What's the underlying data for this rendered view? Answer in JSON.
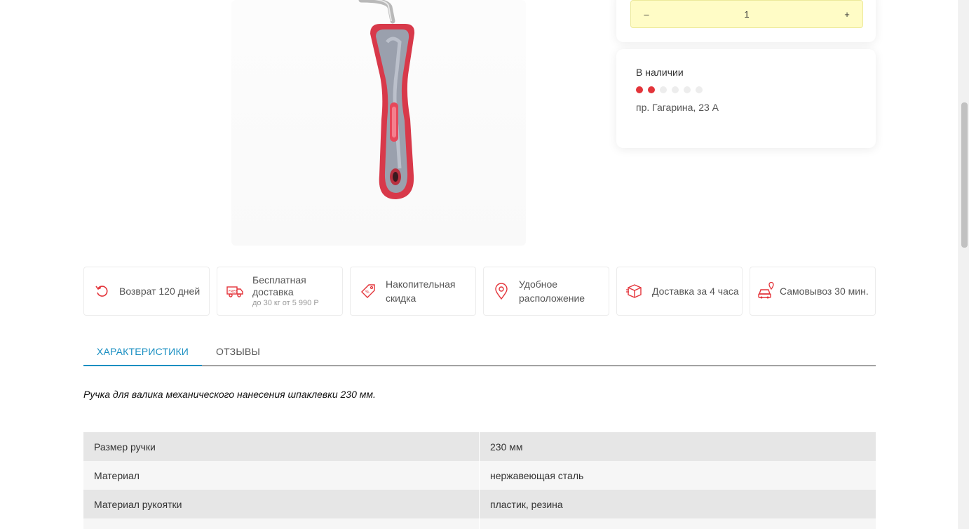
{
  "quantity": {
    "minus_label": "–",
    "value": "1",
    "plus_label": "+"
  },
  "stock": {
    "title": "В наличии",
    "level_filled": 2,
    "level_total": 6,
    "address": "пр. Гагарина, 23 А"
  },
  "features": [
    {
      "icon": "return-arrow-icon",
      "label": "Возврат 120 дней",
      "sub": ""
    },
    {
      "icon": "delivery-truck-icon",
      "label": "Бесплатная доставка",
      "sub": "до 30 кг от 5 990 Р"
    },
    {
      "icon": "discount-tag-icon",
      "label": "Накопительная скидка",
      "sub": ""
    },
    {
      "icon": "location-pin-icon",
      "label": "Удобное расположение",
      "sub": ""
    },
    {
      "icon": "box-icon",
      "label": "Доставка за 4 часа",
      "sub": ""
    },
    {
      "icon": "car-pickup-icon",
      "label": "Самовывоз 30 мин.",
      "sub": ""
    }
  ],
  "tabs": [
    {
      "label": "Характеристики",
      "active": true
    },
    {
      "label": "Отзывы",
      "active": false
    }
  ],
  "description": "Ручка для валика механического нанесения шпаклевки 230 мм.",
  "specs": [
    {
      "key": "Размер ручки",
      "value": "230 мм"
    },
    {
      "key": "Материал",
      "value": "нержавеющая сталь"
    },
    {
      "key": "Материал рукоятки",
      "value": "пластик, резина"
    },
    {
      "key": "",
      "value": ""
    }
  ],
  "colors": {
    "accent_red": "#e3343a",
    "tab_blue": "#1a8fc2",
    "qty_bg": "#fffcc6"
  }
}
